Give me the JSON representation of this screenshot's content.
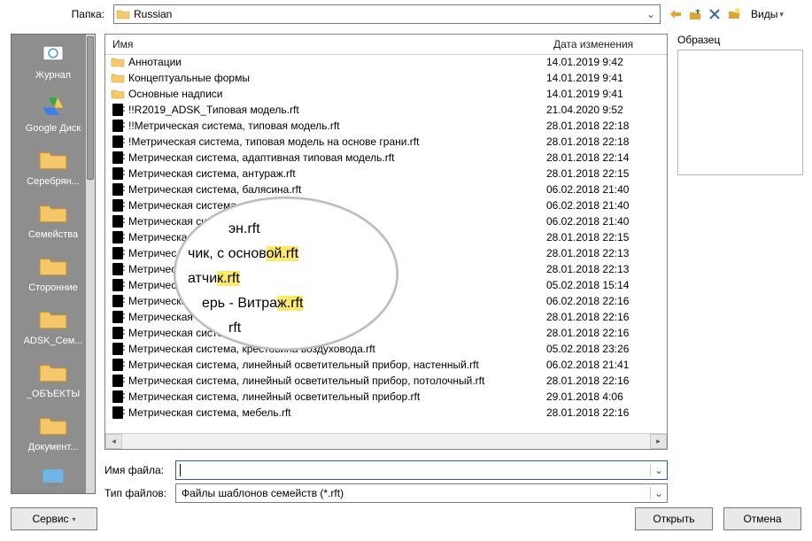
{
  "labels": {
    "folder": "Папка:",
    "views": "Виды",
    "preview": "Образец",
    "col_name": "Имя",
    "col_date": "Дата изменения",
    "filename": "Имя файла:",
    "filetype": "Тип файлов:",
    "service": "Сервис",
    "open": "Открыть",
    "cancel": "Отмена"
  },
  "folder_current": "Russian",
  "filetype_value": "Файлы шаблонов семейств  (*.rft)",
  "filename_value": "",
  "places": [
    {
      "label": "Журнал",
      "icon": "history"
    },
    {
      "label": "Google Диск",
      "icon": "gdrive"
    },
    {
      "label": "Серебрян...",
      "icon": "folder"
    },
    {
      "label": "Семейства",
      "icon": "folder"
    },
    {
      "label": "Сторонние",
      "icon": "folder"
    },
    {
      "label": "ADSK_Сем...",
      "icon": "folder"
    },
    {
      "label": "_ОБЪЕКТЫ",
      "icon": "folder"
    },
    {
      "label": "Документ...",
      "icon": "folder"
    },
    {
      "label": "",
      "icon": "monitor"
    }
  ],
  "files": [
    {
      "t": "folder",
      "name": "Аннотации",
      "date": "14.01.2019 9:42"
    },
    {
      "t": "folder",
      "name": "Концептуальные формы",
      "date": "14.01.2019 9:41"
    },
    {
      "t": "folder",
      "name": "Основные надписи",
      "date": "14.01.2019 9:41"
    },
    {
      "t": "rft",
      "name": "!!R2019_ADSK_Типовая модель.rft",
      "date": "21.04.2020 9:52"
    },
    {
      "t": "rft",
      "name": "!!Метрическая система, типовая модель.rft",
      "date": "28.01.2018 22:18"
    },
    {
      "t": "rft",
      "name": "!Метрическая система, типовая модель на основе грани.rft",
      "date": "28.01.2018 22:18"
    },
    {
      "t": "rft",
      "name": "Метрическая система, адаптивная типовая модель.rft",
      "date": "28.01.2018 22:14"
    },
    {
      "t": "rft",
      "name": "Метрическая система, антураж.rft",
      "date": "28.01.2018 22:15"
    },
    {
      "t": "rft",
      "name": "Метрическая система, балясина.rft",
      "date": "06.02.2018 21:40"
    },
    {
      "t": "rft",
      "name": "Метрическая система",
      "date": "06.02.2018 21:40"
    },
    {
      "t": "rft",
      "name": "Метрическая си",
      "date": "06.02.2018 21:40"
    },
    {
      "t": "rft",
      "name": "Метрическа",
      "date": "28.01.2018 22:15"
    },
    {
      "t": "rft",
      "name": "Метричес",
      "date": "28.01.2018 22:13"
    },
    {
      "t": "rft",
      "name": "Метричес",
      "date": "28.01.2018 22:13"
    },
    {
      "t": "rft",
      "name": "Метричес",
      "date": "05.02.2018 15:14"
    },
    {
      "t": "rft",
      "name": "Метрическа",
      "date": "06.02.2018 22:16"
    },
    {
      "t": "rft",
      "name": "Метрическая си.",
      "date": "28.01.2018 22:16"
    },
    {
      "t": "rft",
      "name": "Метрическая система,",
      "date": "28.01.2018 22:16"
    },
    {
      "t": "rft",
      "name": "Метрическая система, крестовина воздуховода.rft",
      "date": "05.02.2018 23:26"
    },
    {
      "t": "rft",
      "name": "Метрическая система, линейный осветительный прибор, настенный.rft",
      "date": "06.02.2018 21:41"
    },
    {
      "t": "rft",
      "name": "Метрическая система, линейный осветительный прибор, потолочный.rft",
      "date": "28.01.2018 22:16"
    },
    {
      "t": "rft",
      "name": "Метрическая система, линейный осветительный прибор.rft",
      "date": "29.01.2018 4:06"
    },
    {
      "t": "rft",
      "name": "Метрическая система, мебель.rft",
      "date": "28.01.2018 22:16"
    }
  ],
  "magnifier": {
    "l1_a": "эн.",
    "l1_b": "rft",
    "l2_a": "чик, с основ",
    "l2_b": "ой.rft",
    "l3_a": "атчи",
    "l3_b": "к.rft",
    "l4_a": "ерь - Витра",
    "l4_b": "ж.rft",
    "l5_a": "rft"
  }
}
